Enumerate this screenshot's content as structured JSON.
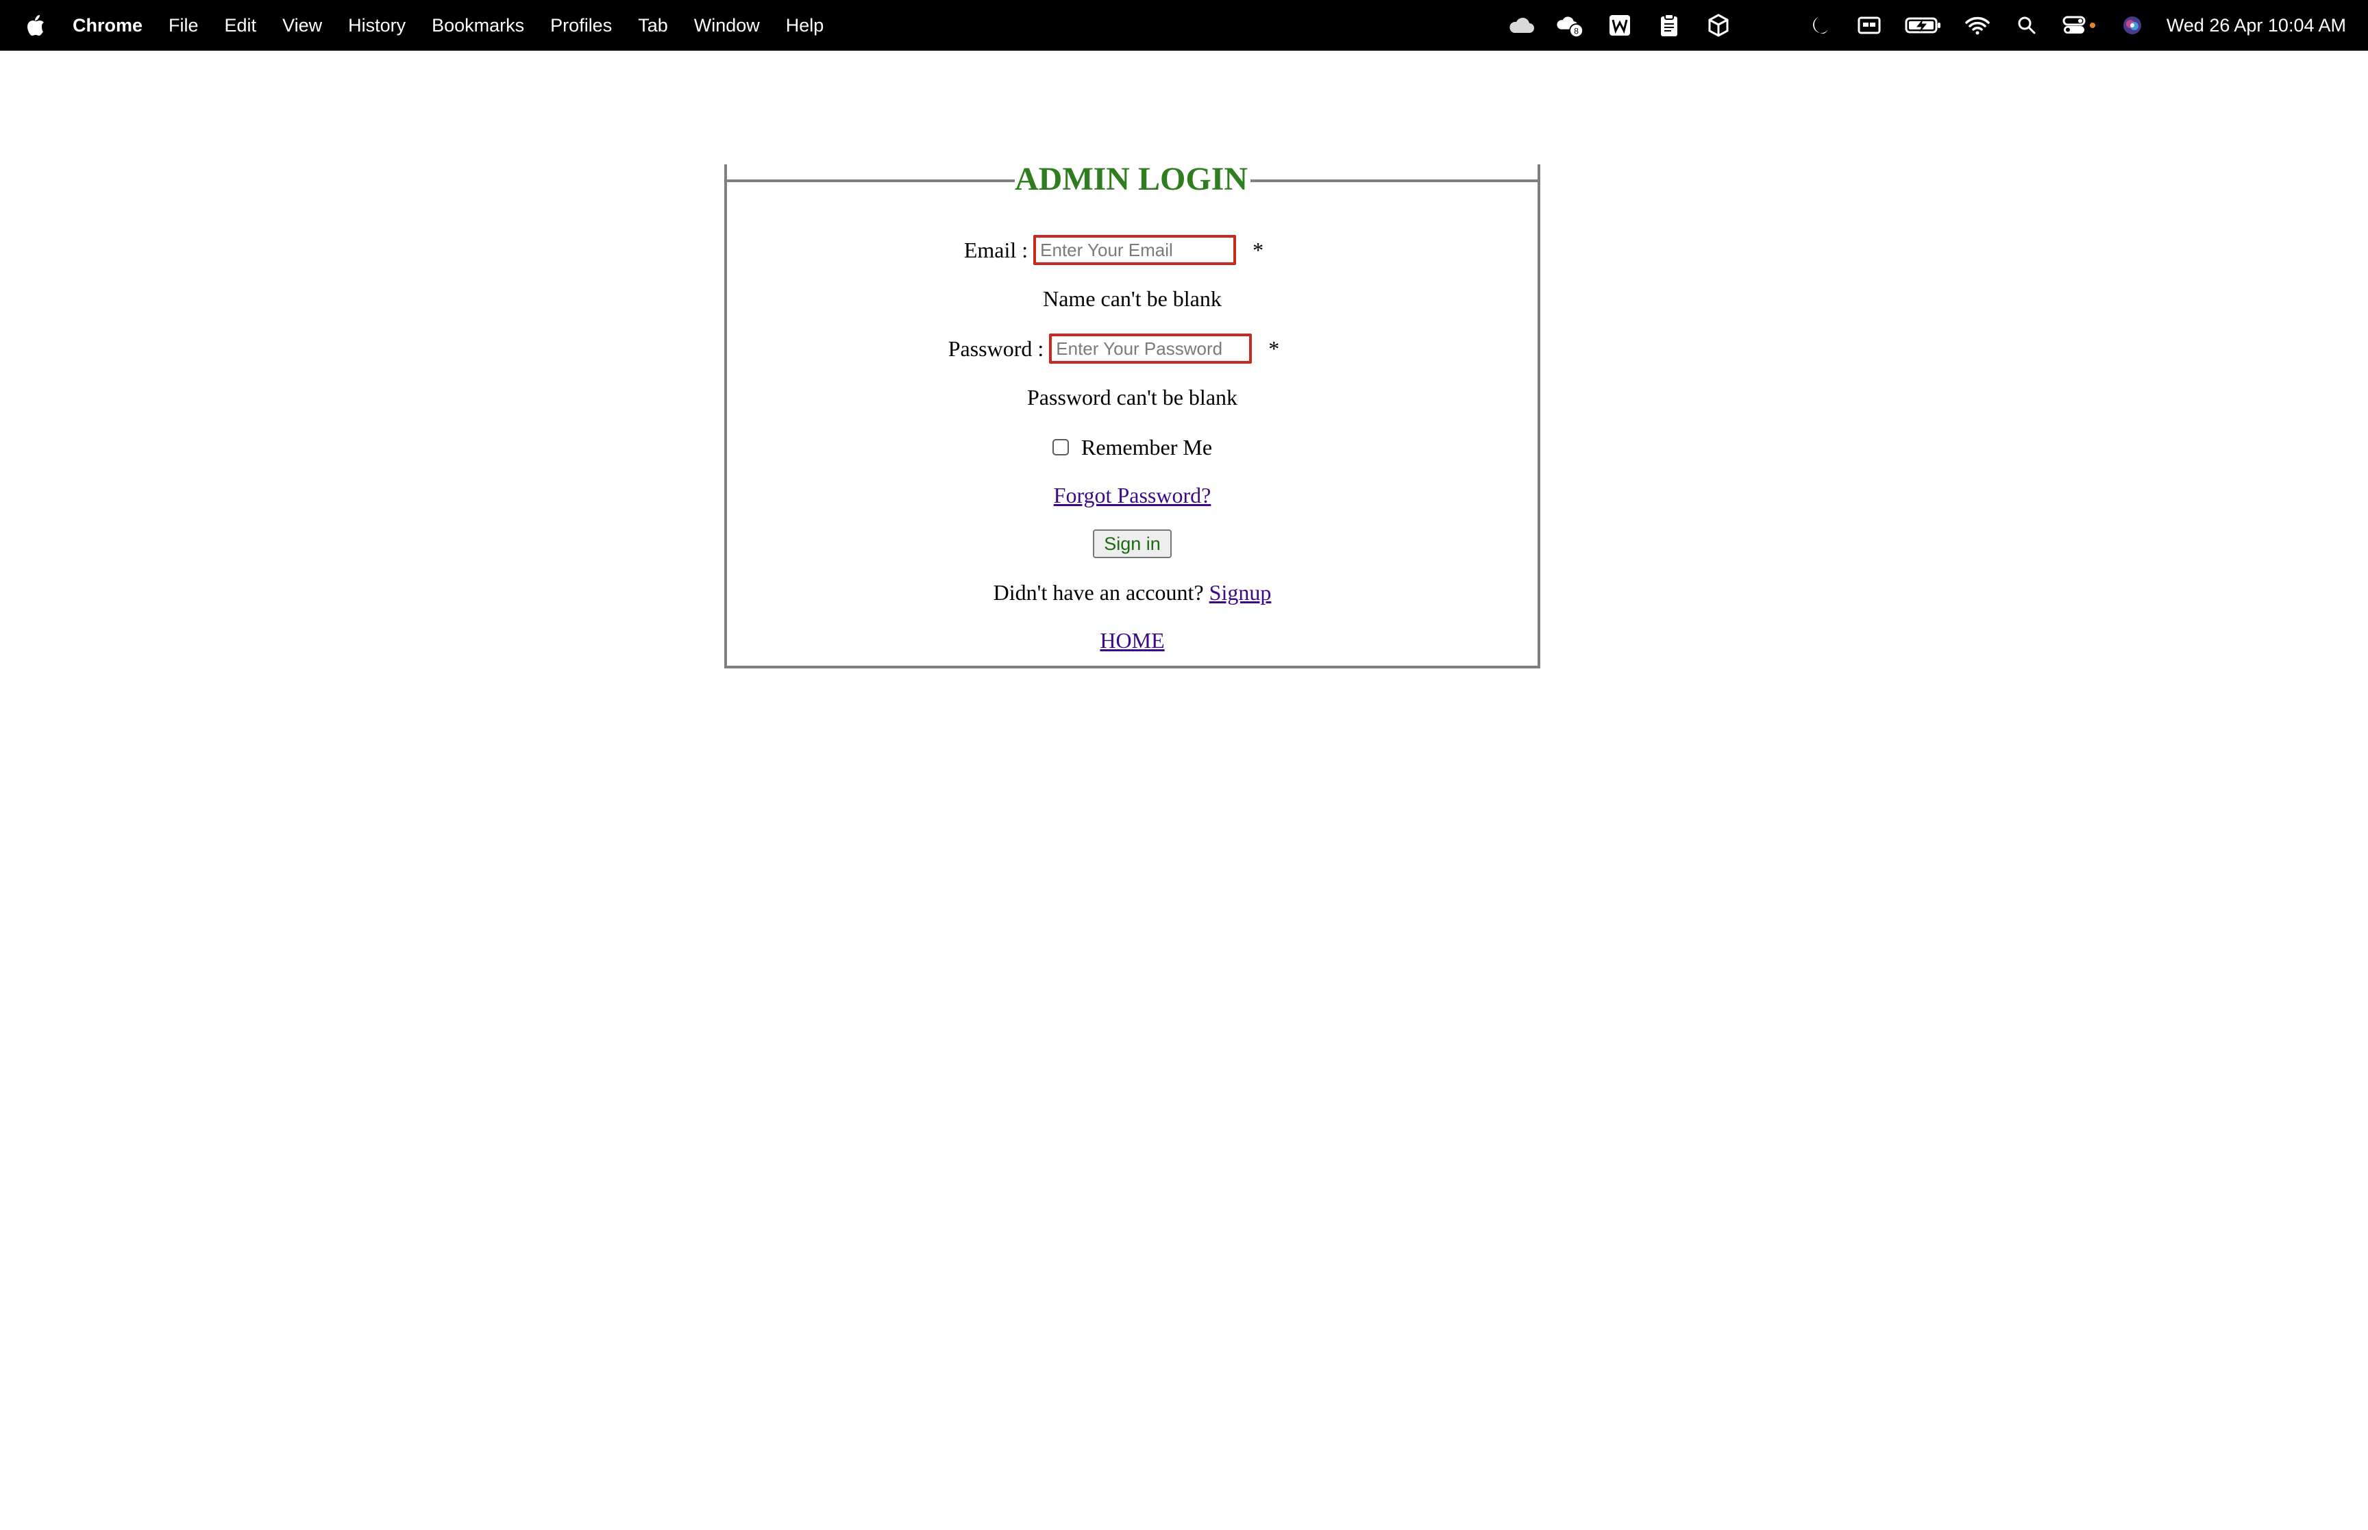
{
  "menubar": {
    "app_name": "Chrome",
    "items": [
      "File",
      "Edit",
      "View",
      "History",
      "Bookmarks",
      "Profiles",
      "Tab",
      "Window",
      "Help"
    ],
    "clock": "Wed 26 Apr  10:04 AM",
    "status_icons": [
      "cloud-icon",
      "weather-badge-icon",
      "w-app-icon",
      "clipboard-icon",
      "box-icon",
      "moon-icon",
      "display-icon",
      "battery-charging-icon",
      "wifi-icon",
      "spotlight-search-icon",
      "control-center-icon",
      "siri-icon"
    ],
    "weather_badge": "8"
  },
  "form": {
    "legend": "ADMIN LOGIN",
    "legend_color": "#2e7d1f",
    "email_label": "Email :",
    "email_placeholder": "Enter Your Email",
    "email_value": "",
    "required_mark": "*",
    "email_error": "Name can't be blank",
    "password_label": "Password :",
    "password_placeholder": "Enter Your Password",
    "password_value": "",
    "password_error": "Password can't be blank",
    "remember_label": "Remember Me",
    "remember_checked": false,
    "forgot_link": "Forgot Password?",
    "signin_button": "Sign in",
    "signup_prompt": "Didn't have an account?",
    "signup_link": "Signup",
    "home_link": "HOME",
    "error_border_color": "#c8281e",
    "link_color": "#3b0a8a"
  }
}
